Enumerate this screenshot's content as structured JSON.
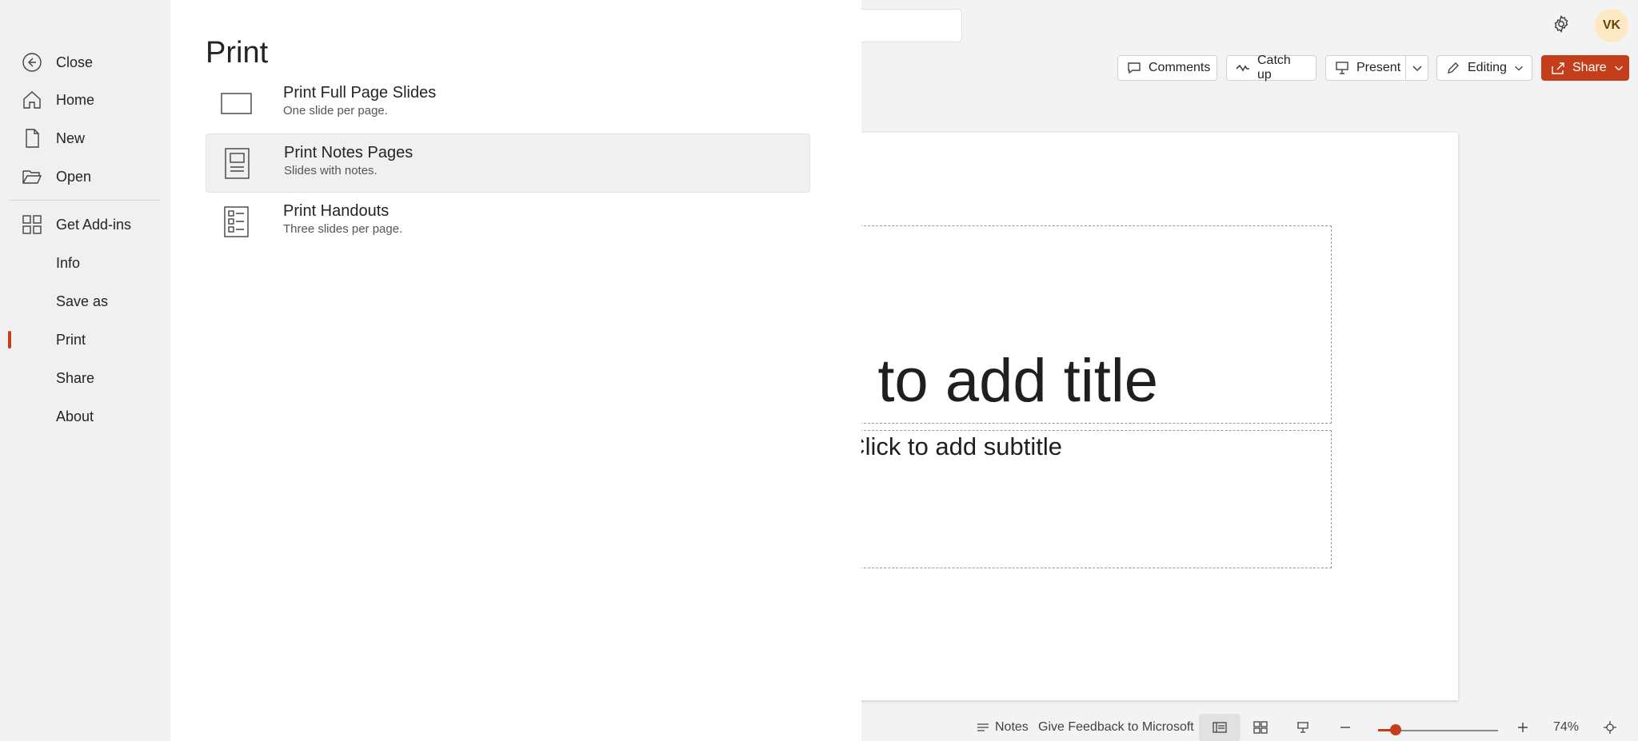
{
  "header": {
    "user_initials": "VK"
  },
  "toolbar": {
    "comments_label": "Comments",
    "catchup_label": "Catch up",
    "present_label": "Present",
    "editing_label": "Editing",
    "share_label": "Share"
  },
  "slide": {
    "title_placeholder": "Click to add title",
    "subtitle_placeholder": "Click to add subtitle"
  },
  "status_bar": {
    "notes_label": "Notes",
    "feedback_label": "Give Feedback to Microsoft",
    "zoom_level": "74%"
  },
  "backstage": {
    "nav": {
      "close": "Close",
      "home": "Home",
      "new": "New",
      "open": "Open",
      "get_addins": "Get Add-ins",
      "info": "Info",
      "save_as": "Save as",
      "print": "Print",
      "share": "Share",
      "about": "About"
    },
    "active_item": "Print",
    "accent_color": "#c43e1c",
    "panel": {
      "heading": "Print",
      "options": [
        {
          "title": "Print Full Page Slides",
          "description": "One slide per page.",
          "icon": "slide-page-icon"
        },
        {
          "title": "Print Notes Pages",
          "description": "Slides with notes.",
          "icon": "notes-page-icon"
        },
        {
          "title": "Print Handouts",
          "description": "Three slides per page.",
          "icon": "handouts-page-icon"
        }
      ],
      "selected_option": "Print Notes Pages"
    }
  }
}
